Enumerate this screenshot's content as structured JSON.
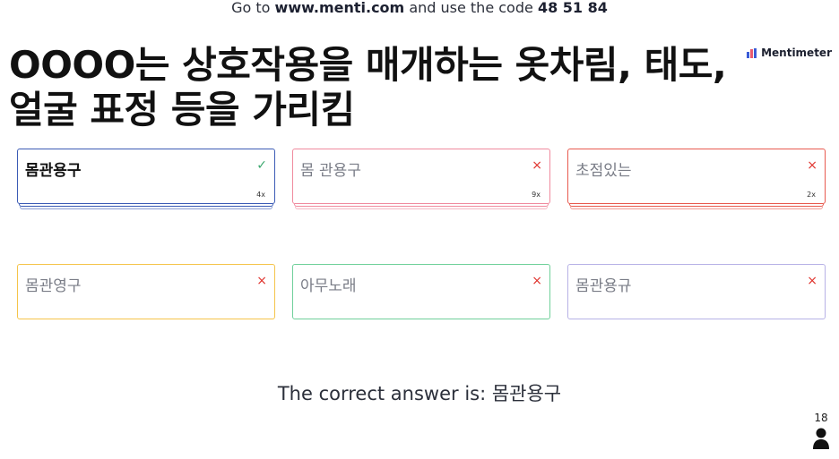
{
  "header": {
    "join_prefix": "Go to",
    "join_url": "www.menti.com",
    "join_middle": "and use the code",
    "join_code": "48 51 84"
  },
  "brand": {
    "name": "Mentimeter",
    "icon": "mentimeter-logo-icon"
  },
  "question": {
    "title": "OOOO는 상호작용을 매개하는 옷차림, 태도, 얼굴 표정 등을 가리킴"
  },
  "options": [
    {
      "label": "몸관용구",
      "status": "correct",
      "mark": "✓",
      "count": "4x",
      "color": "#3b5bb5"
    },
    {
      "label": "몸 관용구",
      "status": "incorrect",
      "mark": "×",
      "count": "9x",
      "color": "#f08a9e"
    },
    {
      "label": "초점있는",
      "status": "incorrect",
      "mark": "×",
      "count": "2x",
      "color": "#e85a4f"
    },
    {
      "label": "몸관영구",
      "status": "incorrect",
      "mark": "×",
      "color": "#f5c44a"
    },
    {
      "label": "아무노래",
      "status": "incorrect",
      "mark": "×",
      "color": "#6fd09a"
    },
    {
      "label": "몸관용규",
      "status": "incorrect",
      "mark": "×",
      "color": "#b7b2e6"
    }
  ],
  "answer": {
    "text": "The correct answer is: 몸관용구"
  },
  "participants": {
    "count": "18",
    "icon": "person-icon"
  },
  "colors": {
    "correct_mark": "#3aa76d",
    "incorrect_mark": "#e0352f",
    "text": "#101834"
  }
}
